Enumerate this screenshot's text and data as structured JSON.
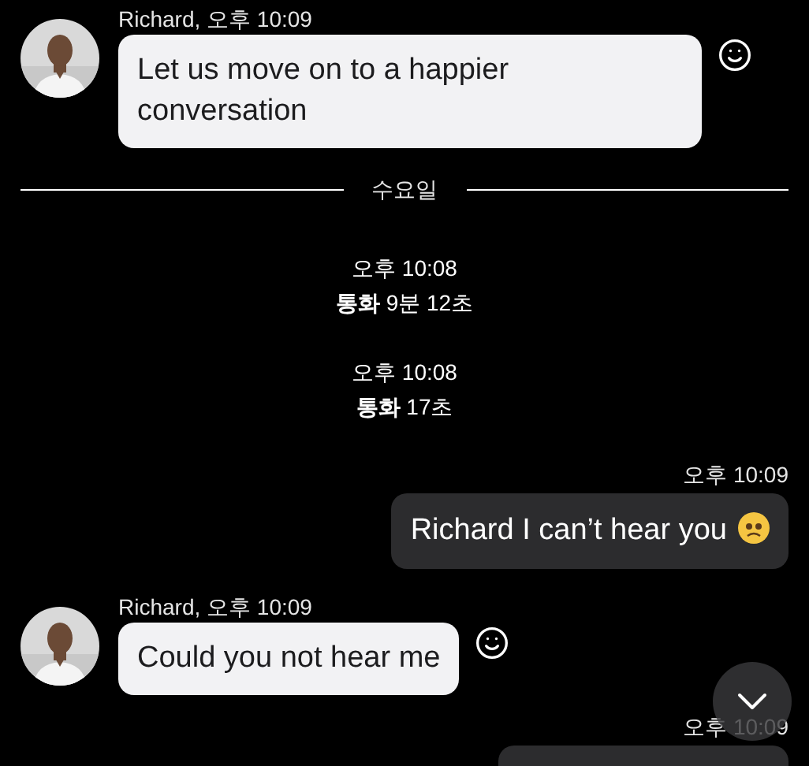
{
  "messages": [
    {
      "kind": "incoming",
      "sender": "Richard, 오후 10:09",
      "text": "Let us move on to a happier conversation"
    },
    {
      "kind": "divider",
      "label": "수요일"
    },
    {
      "kind": "call",
      "time": "오후 10:08",
      "label": "통화",
      "duration": "9분 12초"
    },
    {
      "kind": "call",
      "time": "오후 10:08",
      "label": "통화",
      "duration": "17초"
    },
    {
      "kind": "outgoing",
      "time": "오후 10:09",
      "text": "Richard I can’t hear you",
      "sad_face": true
    },
    {
      "kind": "incoming",
      "sender": "Richard, 오후 10:09",
      "text": "Could you not hear me"
    },
    {
      "kind": "outgoing-partial",
      "time": "오후 10:09"
    }
  ]
}
